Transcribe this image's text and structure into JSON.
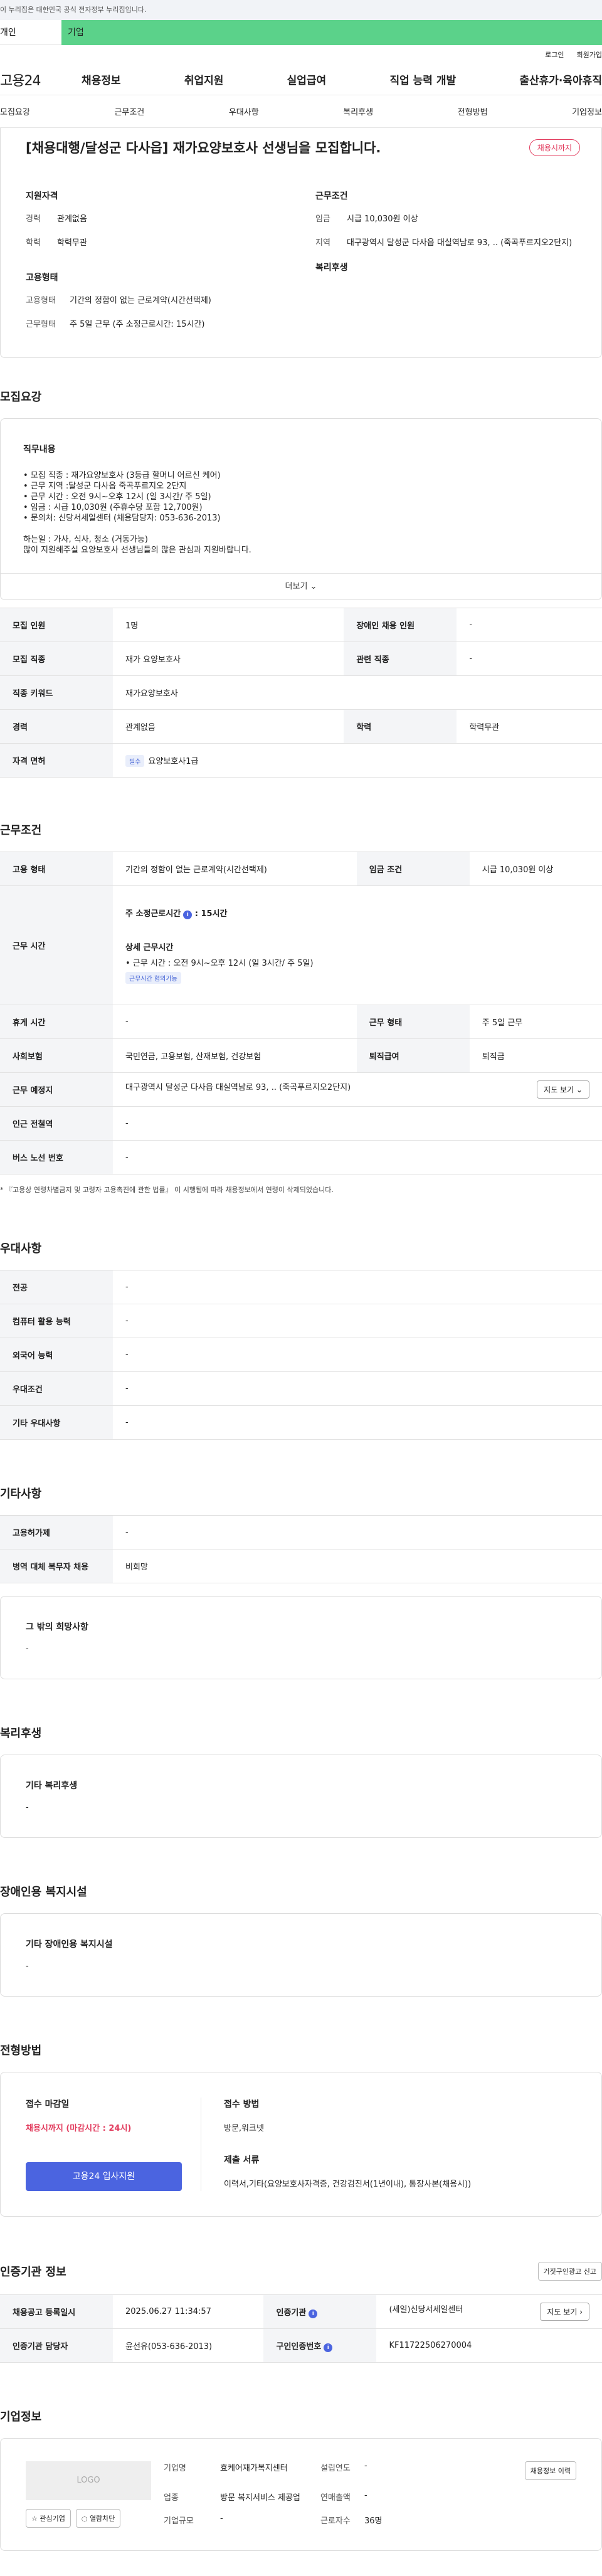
{
  "top": {
    "gov_notice": "이 누리집은 대한민국 공식 전자정부 누리집입니다.",
    "tab_personal": "개인",
    "tab_biz": "기업",
    "login": "로그인",
    "signup": "회원가입"
  },
  "gnb": {
    "logo": "고용24",
    "menu": [
      "채용정보",
      "취업지원",
      "실업급여",
      "직업 능력 개발",
      "출산휴가·육아휴직"
    ]
  },
  "subnav": [
    "모집요강",
    "근무조건",
    "우대사항",
    "복리후생",
    "전형방법",
    "기업정보"
  ],
  "summary": {
    "title": "[채용대행/달성군 다사읍] 재가요양보호사 선생님을 모집합니다.",
    "badge": "채용시까지",
    "qual_h": "지원자격",
    "exp_k": "경력",
    "exp_v": "관계없음",
    "edu_k": "학력",
    "edu_v": "학력무관",
    "emp_h": "고용형태",
    "emptype_k": "고용형태",
    "emptype_v": "기간의 정함이 없는 근로계약(시간선택제)",
    "worktype_k": "근무형태",
    "worktype_v": "주 5일 근무 (주 소정근로시간: 15시간)",
    "cond_h": "근무조건",
    "wage_k": "임금",
    "wage_v": "시급 10,030원 이상",
    "area_k": "지역",
    "area_v": "대구광역시 달성군 다사읍 대실역남로 93, .. (죽곡푸르지오2단지)",
    "welfare_h": "복리후생"
  },
  "recruit": {
    "heading": "모집요강",
    "duty_h": "직무내용",
    "lines": [
      "• 모집 직종 : 재가요양보호사 (3등급 할머니 어르신 케어)",
      "• 근무 지역 :달성군 다사읍 죽곡푸르지오 2단지",
      "• 근무 시간 : 오전 9시~오후 12시 (일 3시간/ 주 5일)",
      "• 임금 : 시급 10,030원 (주휴수당 포함 12,700원)",
      "• 문의처: 신당서세일센터 (채용담당자: 053-636-2013)",
      "",
      "하는일 : 가사, 식사, 청소 (거동가능)",
      "많이 지원해주실 요양보호사 선생님들의 많은 관심과 지원바랍니다."
    ],
    "more": "더보기 ⌄",
    "table": {
      "count_k": "모집 인원",
      "count_v": "1명",
      "disabled_k": "장애인 채용 인원",
      "disabled_v": "-",
      "job_k": "모집 직종",
      "job_v": "재가 요양보호사",
      "related_k": "관련 직종",
      "related_v": "-",
      "keyword_k": "직종 키워드",
      "keyword_v": "재가요양보호사",
      "exp_k": "경력",
      "exp_v": "관계없음",
      "edu_k": "학력",
      "edu_v": "학력무관",
      "license_k": "자격 면허",
      "license_chip": "필수",
      "license_v": "요양보호사1급"
    }
  },
  "work": {
    "heading": "근무조건",
    "emptype_k": "고용 형태",
    "emptype_v": "기간의 정함이 없는 근로계약(시간선택제)",
    "wage_k": "임금 조건",
    "wage_v": "시급 10,030원 이상",
    "hours_k": "근무 시간",
    "hours_main": "주 소정근로시간",
    "hours_num": ": 15시간",
    "hours_detail_h": "상세 근무시간",
    "hours_detail": "• 근무 시간 : 오전 9시~오후 12시 (일 3시간/ 주 5일)",
    "hours_chip": "근무시간 협의가능",
    "rest_k": "휴게 시간",
    "rest_v": "-",
    "form_k": "근무 형태",
    "form_v": "주 5일 근무",
    "insurance_k": "사회보험",
    "insurance_v": "국민연금, 고용보험, 산재보험, 건강보험",
    "severance_k": "퇴직급여",
    "severance_v": "퇴직금",
    "place_k": "근무 예정지",
    "place_v": "대구광역시 달성군 다사읍 대실역남로 93, .. (죽곡푸르지오2단지)",
    "map_btn": "지도 보기 ⌄",
    "subway_k": "인근 전철역",
    "subway_v": "-",
    "bus_k": "버스 노선 번호",
    "bus_v": "-",
    "note": "* 『고용상 연령차별금지 및 고령자 고용촉진에 관한 법률』 이 시행됨에 따라 채용정보에서 연령이 삭제되었습니다."
  },
  "prefer": {
    "heading": "우대사항",
    "major_k": "전공",
    "major_v": "-",
    "computer_k": "컴퓨터 활용 능력",
    "computer_v": "-",
    "lang_k": "외국어 능력",
    "lang_v": "-",
    "cond_k": "우대조건",
    "cond_v": "-",
    "etc_k": "기타 우대사항",
    "etc_v": "-"
  },
  "other": {
    "heading": "기타사항",
    "permit_k": "고용허가제",
    "permit_v": "-",
    "military_k": "병역 대체 복무자 채용",
    "military_v": "비희망",
    "wish_h": "그 밖의 희망사항",
    "wish_v": "-"
  },
  "welfare": {
    "heading": "복리후생",
    "box_h": "기타 복리후생",
    "box_v": "-"
  },
  "disabled": {
    "heading": "장애인용 복지시설",
    "box_h": "기타 장애인용 복지시설",
    "box_v": "-"
  },
  "process": {
    "heading": "전형방법",
    "deadline_h": "접수 마감일",
    "deadline_v": "채용시까지 (마감시간 : 24시)",
    "apply_btn": "고용24 입사지원",
    "method_h": "접수 방법",
    "method_v": "방문,워크넷",
    "docs_h": "제출 서류",
    "docs_v": "이력서,기타(요양보호사자격증, 건강검진서(1년이내), 통장사본(채용시))"
  },
  "cert": {
    "heading": "인증기관 정보",
    "report_btn": "거짓구인광고 신고",
    "date_k": "채용공고 등록일시",
    "date_v": "2025.06.27 11:34:57",
    "org_k": "인증기관",
    "org_v": "(세일)신당서세일센터",
    "map_btn": "지도 보기 ›",
    "manager_k": "인증기관 담당자",
    "manager_v": "윤선유(053-636-2013)",
    "id_k": "구인인증번호",
    "id_v": "KF11722506270004"
  },
  "company": {
    "heading": "기업정보",
    "logo": "LOGO",
    "fav_btn": "☆ 관심기업",
    "block_btn": "◌ 열람차단",
    "name_k": "기업명",
    "name_v": "효케어재가복지센터",
    "industry_k": "업종",
    "industry_v": "방문 복지서비스 제공업",
    "size_k": "기업규모",
    "size_v": "-",
    "founded_k": "설립연도",
    "founded_v": "-",
    "revenue_k": "연매출액",
    "revenue_v": "-",
    "staff_k": "근로자수",
    "staff_v": "36명",
    "history_btn": "채용정보 이력"
  }
}
